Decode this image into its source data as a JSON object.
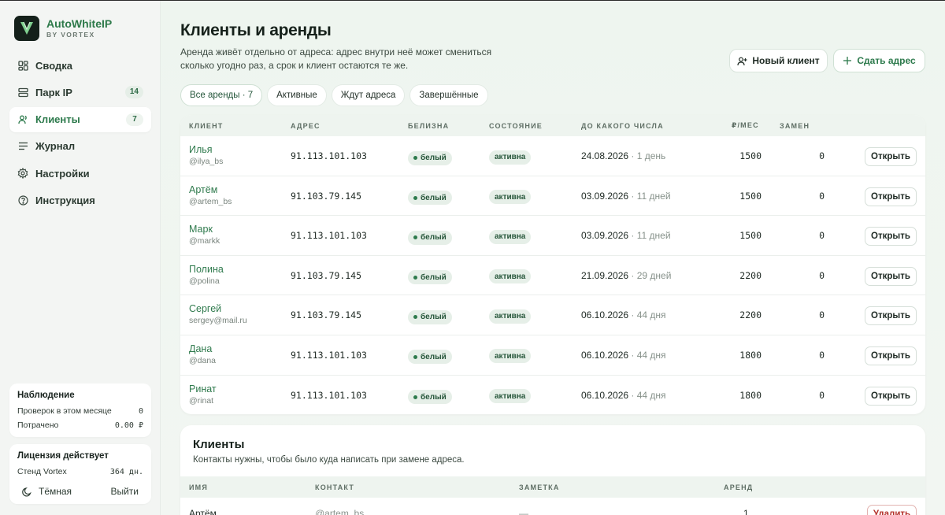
{
  "brand": {
    "name": "AutoWhiteIP",
    "sub": "BY VORTEX"
  },
  "nav": [
    {
      "label": "Сводка",
      "icon": "dashboard-icon",
      "badge": ""
    },
    {
      "label": "Парк IP",
      "icon": "server-icon",
      "badge": "14"
    },
    {
      "label": "Клиенты",
      "icon": "users-icon",
      "badge": "7"
    },
    {
      "label": "Журнал",
      "icon": "log-icon",
      "badge": ""
    },
    {
      "label": "Настройки",
      "icon": "gear-icon",
      "badge": ""
    },
    {
      "label": "Инструкция",
      "icon": "help-icon",
      "badge": ""
    }
  ],
  "watch": {
    "title": "Наблюдение",
    "rows": [
      {
        "label": "Проверок в этом месяце",
        "value": "0"
      },
      {
        "label": "Потрачено",
        "value": "0.00 ₽"
      }
    ]
  },
  "license": {
    "title": "Лицензия действует",
    "label": "Стенд Vortex",
    "value": "364 дн.",
    "theme_label": "Тёмная",
    "logout_label": "Выйти"
  },
  "header": {
    "title": "Клиенты и аренды",
    "subtitle": "Аренда живёт отдельно от адреса: адрес внутри неё может смениться сколько угодно раз, а срок и клиент остаются те же.",
    "new_client": "Новый клиент",
    "give_address": "Сдать адрес"
  },
  "filters": [
    "Все аренды · 7",
    "Активные",
    "Ждут адреса",
    "Завершённые"
  ],
  "rentals": {
    "columns": {
      "client": "КЛИЕНТ",
      "address": "АДРЕС",
      "white": "БЕЛИЗНА",
      "state": "СОСТОЯНИЕ",
      "until": "ДО КАКОГО ЧИСЛА",
      "price": "₽/МЕС",
      "replacements": "ЗАМЕН"
    },
    "open_label": "Открыть",
    "rows": [
      {
        "name": "Илья",
        "handle": "@ilya_bs",
        "address": "91.113.101.103",
        "white": "белый",
        "state": "активна",
        "date": "24.08.2026",
        "rest": "· 1 день",
        "price": "1500",
        "repl": "0"
      },
      {
        "name": "Артём",
        "handle": "@artem_bs",
        "address": "91.103.79.145",
        "white": "белый",
        "state": "активна",
        "date": "03.09.2026",
        "rest": "· 11 дней",
        "price": "1500",
        "repl": "0"
      },
      {
        "name": "Марк",
        "handle": "@markk",
        "address": "91.113.101.103",
        "white": "белый",
        "state": "активна",
        "date": "03.09.2026",
        "rest": "· 11 дней",
        "price": "1500",
        "repl": "0"
      },
      {
        "name": "Полина",
        "handle": "@polina",
        "address": "91.103.79.145",
        "white": "белый",
        "state": "активна",
        "date": "21.09.2026",
        "rest": "· 29 дней",
        "price": "2200",
        "repl": "0"
      },
      {
        "name": "Сергей",
        "handle": "sergey@mail.ru",
        "address": "91.103.79.145",
        "white": "белый",
        "state": "активна",
        "date": "06.10.2026",
        "rest": "· 44 дня",
        "price": "2200",
        "repl": "0"
      },
      {
        "name": "Дана",
        "handle": "@dana",
        "address": "91.113.101.103",
        "white": "белый",
        "state": "активна",
        "date": "06.10.2026",
        "rest": "· 44 дня",
        "price": "1800",
        "repl": "0"
      },
      {
        "name": "Ринат",
        "handle": "@rinat",
        "address": "91.113.101.103",
        "white": "белый",
        "state": "активна",
        "date": "06.10.2026",
        "rest": "· 44 дня",
        "price": "1800",
        "repl": "0"
      }
    ]
  },
  "clients": {
    "title": "Клиенты",
    "subtitle": "Контакты нужны, чтобы было куда написать при замене адреса.",
    "columns": {
      "name": "ИМЯ",
      "contact": "КОНТАКТ",
      "note": "ЗАМЕТКА",
      "rentals": "АРЕНД"
    },
    "rows": [
      {
        "name": "Артём",
        "contact": "@artem_bs",
        "note": "—",
        "rentals": "1",
        "delete": "Удалить"
      }
    ]
  },
  "colors": {
    "accent": "#2d7a4c",
    "danger": "#b3302a",
    "bg": "#eef5ef"
  }
}
